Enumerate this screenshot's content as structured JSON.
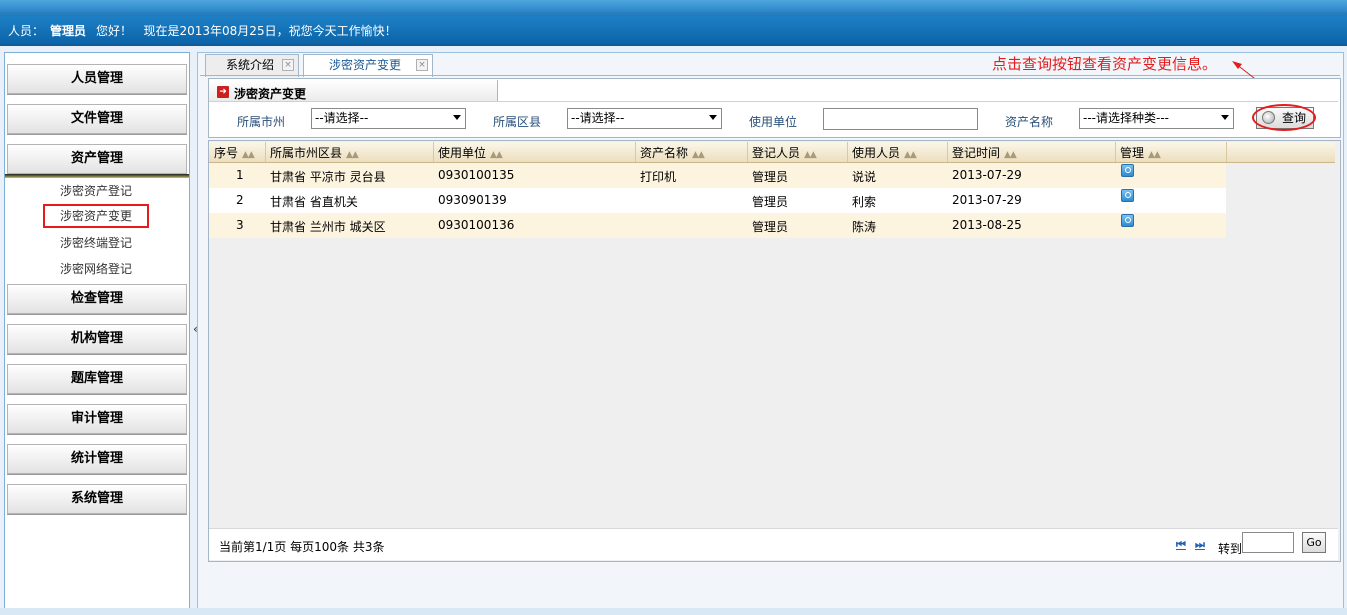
{
  "header": {
    "user_label": "人员：",
    "user_name": "管理员",
    "greeting": "您好！",
    "date_text": "现在是2013年08月25日，祝您今天工作愉快！"
  },
  "sidebar": {
    "menus": [
      {
        "label": "人员管理"
      },
      {
        "label": "文件管理"
      },
      {
        "label": "资产管理"
      },
      {
        "label": "检查管理"
      },
      {
        "label": "机构管理"
      },
      {
        "label": "题库管理"
      },
      {
        "label": "审计管理"
      },
      {
        "label": "统计管理"
      },
      {
        "label": "系统管理"
      }
    ],
    "asset_submenu": [
      {
        "label": "涉密资产登记"
      },
      {
        "label": "涉密资产变更",
        "active": true
      },
      {
        "label": "涉密终端登记"
      },
      {
        "label": "涉密网络登记"
      }
    ],
    "collapse_glyph": "«"
  },
  "tabs": [
    {
      "label": "系统介绍"
    },
    {
      "label": "涉密资产变更",
      "active": true
    }
  ],
  "annotation": "点击查询按钮查看资产变更信息。",
  "query": {
    "title": "涉密资产变更",
    "fields": [
      {
        "label": "所属市州",
        "value": "--请选择--"
      },
      {
        "label": "所属区县",
        "value": "--请选择--"
      },
      {
        "label": "使用单位",
        "value": ""
      },
      {
        "label": "资产名称",
        "value": "---请选择种类---"
      }
    ],
    "button_label": "查询"
  },
  "grid": {
    "columns": [
      "序号",
      "所属市州区县",
      "使用单位",
      "资产名称",
      "登记人员",
      "使用人员",
      "登记时间",
      "管理"
    ],
    "rows": [
      [
        "1",
        "甘肃省 平凉市 灵台县",
        "0930100135",
        "打印机",
        "管理员",
        "说说",
        "2013-07-29"
      ],
      [
        "2",
        "甘肃省 省直机关",
        "093090139",
        "",
        "管理员",
        "利索",
        "2013-07-29"
      ],
      [
        "3",
        "甘肃省 兰州市 城关区",
        "0930100136",
        "",
        "管理员",
        "陈涛",
        "2013-08-25"
      ]
    ]
  },
  "pager": {
    "summary": "当前第1/1页  每页100条  共3条",
    "first": "⏮",
    "last": "⏭",
    "goto_label": "转到",
    "go_label": "Go"
  },
  "colors": {
    "accent_red": "#e41c1c",
    "header_blue": "#1b6fb2",
    "odd_row": "#fdf4e0"
  }
}
